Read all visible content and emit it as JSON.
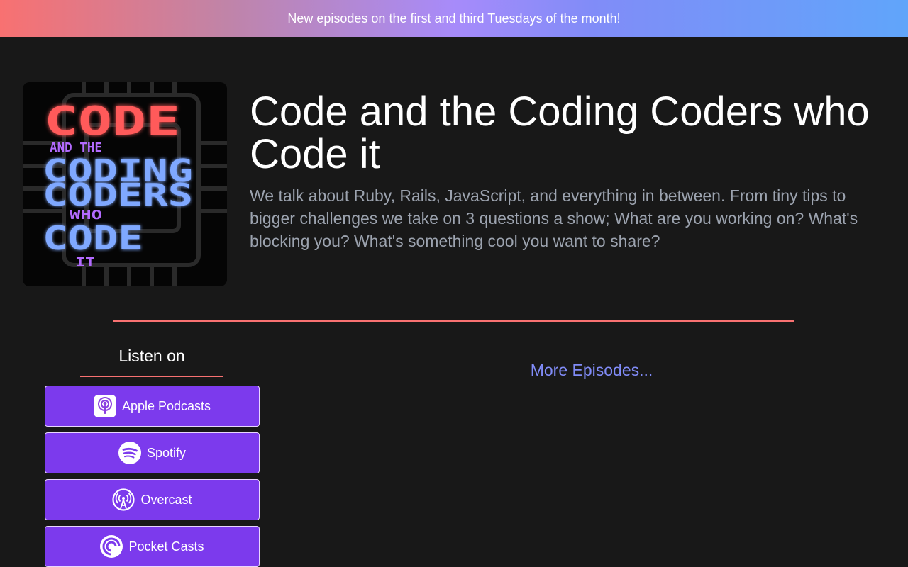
{
  "banner": {
    "text": "New episodes on the first and third Tuesdays of the month!"
  },
  "podcast": {
    "artwork_lines": [
      "CODE",
      "AND THE",
      "CODING",
      "CODERS",
      "WHO",
      "CODE",
      "IT"
    ],
    "title": "Code and the Coding Coders who Code it",
    "description": "We talk about Ruby, Rails, JavaScript, and everything in between. From tiny tips to bigger challenges we take on 3 questions a show; What are you working on? What's blocking you? What's something cool you want to share?"
  },
  "listen": {
    "heading": "Listen on",
    "platforms": [
      {
        "label": "Apple Podcasts",
        "icon": "apple-podcasts-icon"
      },
      {
        "label": "Spotify",
        "icon": "spotify-icon"
      },
      {
        "label": "Overcast",
        "icon": "overcast-icon"
      },
      {
        "label": "Pocket Casts",
        "icon": "pocket-casts-icon"
      }
    ]
  },
  "episodes": {
    "more_label": "More Episodes..."
  },
  "colors": {
    "background": "#181818",
    "accent_divider": "#f87171",
    "button_bg": "#7c3aed",
    "link": "#818cf8",
    "art_red": "#ff5a5a",
    "art_blue": "#7fa8ff",
    "art_purple": "#b36bff"
  }
}
